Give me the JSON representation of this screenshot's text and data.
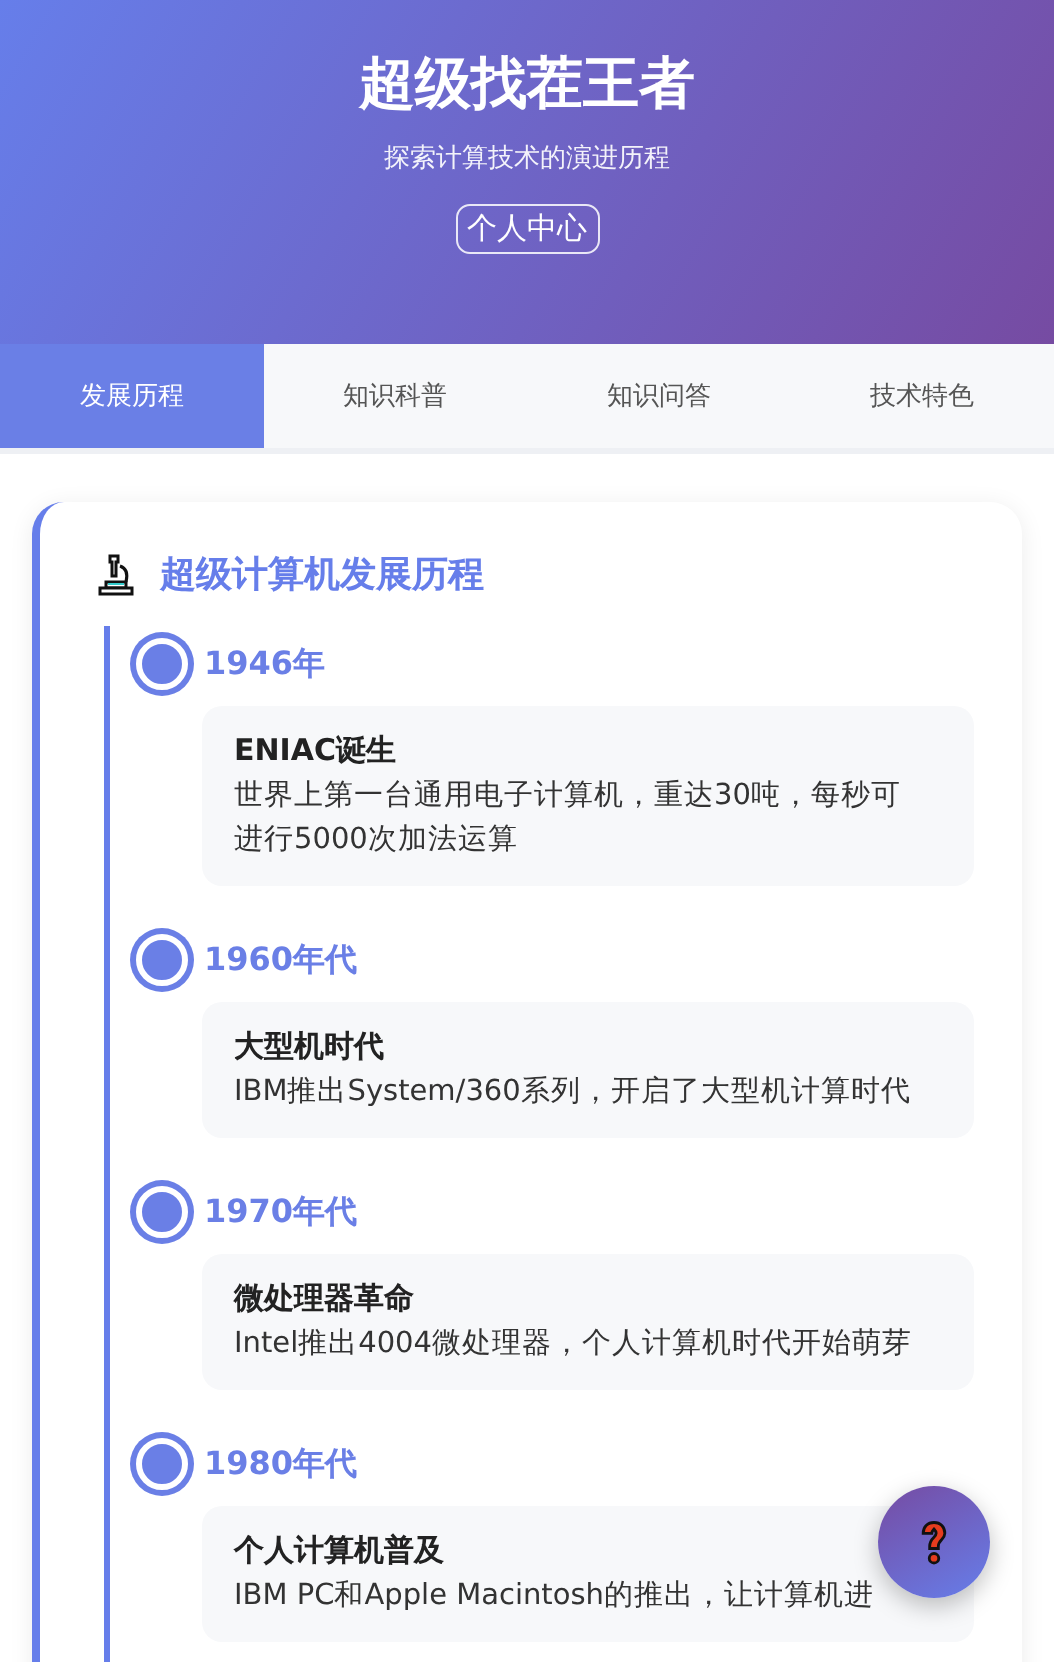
{
  "header": {
    "title": "超级找茬王者",
    "subtitle": "探索计算技术的演进历程",
    "profile_button": "个人中心"
  },
  "tabs": [
    {
      "label": "发展历程",
      "selected": true
    },
    {
      "label": "知识科普",
      "selected": false
    },
    {
      "label": "知识问答",
      "selected": false
    },
    {
      "label": "技术特色",
      "selected": false
    }
  ],
  "section": {
    "title": "超级计算机发展历程"
  },
  "timeline": [
    {
      "year": "1946年",
      "title": "ENIAC诞生",
      "description": "世界上第一台通用电子计算机，重达30吨，每秒可进行5000次加法运算"
    },
    {
      "year": "1960年代",
      "title": "大型机时代",
      "description": "IBM推出System/360系列，开启了大型机计算时代"
    },
    {
      "year": "1970年代",
      "title": "微处理器革命",
      "description": "Intel推出4004微处理器，个人计算机时代开始萌芽"
    },
    {
      "year": "1980年代",
      "title": "个人计算机普及",
      "description": "IBM PC和Apple Macintosh的推出，让计算机进"
    }
  ]
}
